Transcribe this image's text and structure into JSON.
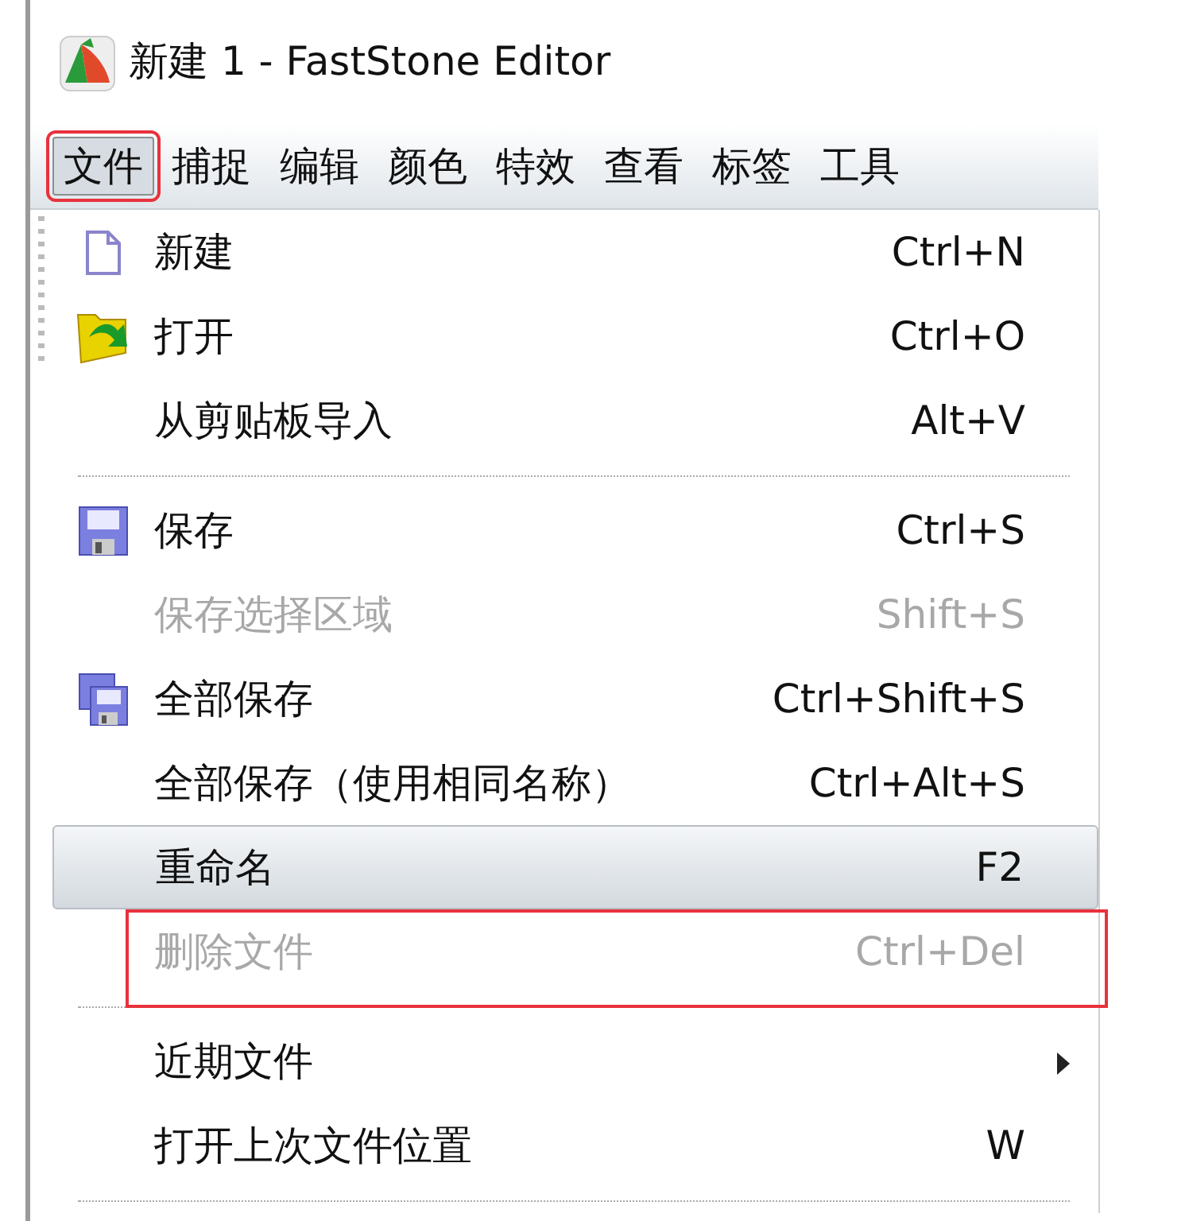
{
  "window": {
    "title": "新建 1 - FastStone Editor"
  },
  "menu_bar": [
    {
      "label": "文件",
      "selected": true,
      "annotated": true
    },
    {
      "label": "捕捉",
      "selected": false,
      "annotated": false
    },
    {
      "label": "编辑",
      "selected": false,
      "annotated": false
    },
    {
      "label": "颜色",
      "selected": false,
      "annotated": false
    },
    {
      "label": "特效",
      "selected": false,
      "annotated": false
    },
    {
      "label": "查看",
      "selected": false,
      "annotated": false
    },
    {
      "label": "标签",
      "selected": false,
      "annotated": false
    },
    {
      "label": "工具",
      "selected": false,
      "annotated": false
    }
  ],
  "menu": [
    {
      "kind": "item",
      "label": "新建",
      "shortcut": "Ctrl+N",
      "disabled": false,
      "selected": false,
      "annotated": false
    },
    {
      "kind": "item",
      "label": "打开",
      "shortcut": "Ctrl+O",
      "disabled": false,
      "selected": false,
      "annotated": false
    },
    {
      "kind": "item",
      "label": "从剪贴板导入",
      "shortcut": "Alt+V",
      "disabled": false,
      "selected": false,
      "annotated": false
    },
    {
      "kind": "separator"
    },
    {
      "kind": "item",
      "label": "保存",
      "shortcut": "Ctrl+S",
      "disabled": false,
      "selected": false,
      "annotated": false
    },
    {
      "kind": "item",
      "label": "保存选择区域",
      "shortcut": "Shift+S",
      "disabled": true,
      "selected": false,
      "annotated": false
    },
    {
      "kind": "item",
      "label": "全部保存",
      "shortcut": "Ctrl+Shift+S",
      "disabled": false,
      "selected": false,
      "annotated": false
    },
    {
      "kind": "item",
      "label": "全部保存（使用相同名称）",
      "shortcut": "Ctrl+Alt+S",
      "disabled": false,
      "selected": false,
      "annotated": false
    },
    {
      "kind": "item",
      "label": "重命名",
      "shortcut": "F2",
      "disabled": false,
      "selected": true,
      "annotated": false
    },
    {
      "kind": "item",
      "label": "删除文件",
      "shortcut": "Ctrl+Del",
      "disabled": true,
      "selected": false,
      "annotated": true
    },
    {
      "kind": "separator"
    },
    {
      "kind": "submenu",
      "label": "近期文件",
      "disabled": false,
      "selected": false,
      "annotated": false
    },
    {
      "kind": "item",
      "label": "打开上次文件位置",
      "shortcut": "W",
      "disabled": false,
      "selected": false,
      "annotated": false
    },
    {
      "kind": "separator"
    }
  ]
}
